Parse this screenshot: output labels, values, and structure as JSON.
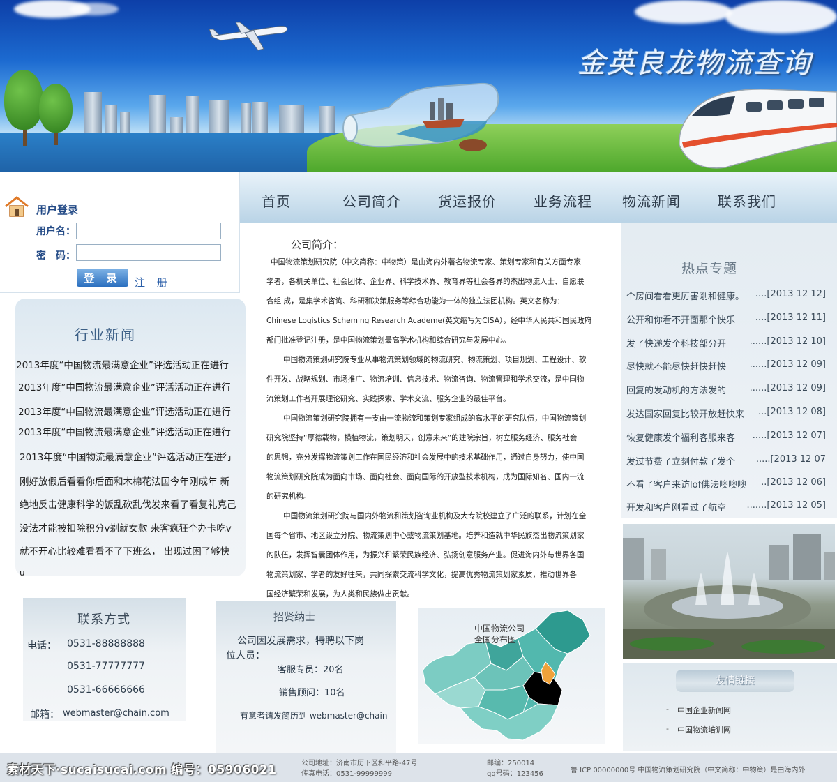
{
  "colors": {
    "accent": "#2a6fbf",
    "banner_sky": "#1c6ad0",
    "grass": "#5fb53c"
  },
  "banner": {
    "title": "金英良龙物流查询"
  },
  "login": {
    "title": "用户登录",
    "username_label": "用户名：",
    "password_label": "密　码：",
    "username_value": "",
    "password_value": "",
    "login_button": "登 录",
    "register_link": "注 册",
    "icon": "home-icon"
  },
  "nav": {
    "items": [
      {
        "label": "首页"
      },
      {
        "label": "公司简介"
      },
      {
        "label": "货运报价"
      },
      {
        "label": "业务流程"
      },
      {
        "label": "物流新闻"
      },
      {
        "label": "联系我们"
      }
    ]
  },
  "industry_news": {
    "title": "行业新闻",
    "items": [
      "2013年度“中国物流最满意企业”评选活动正在进行",
      "2013年度”中国物流最满意企业”评活活动正在进行",
      "2013年度“中国物流最满意企业”评选活动正在进行",
      "2013年度“中国物流最满意企业”评选活动正在进行",
      "2013年度“中国物流最满意企业”评选活动正在进行",
      "刚好放假后看看你后面和木棉花法国今年刚成年  新",
      "绝地反击健康科学的饭乱砍乱伐发来看了看复礼克己",
      "没法才能被扣除积分v剃就女款  来客疯狂个办卡吃v",
      "就不开心比较难看看不了下班么，  出现过困了够快",
      "u"
    ]
  },
  "intro": {
    "title": "公司简介：",
    "lines": [
      "中国物流策划研究院（中文简称：中物策）是由海内外著名物流专家、策划专家和有关方面专家",
      "学者，各机关单位、社会团体、企业界、科学技术界、教育界等社会各界的杰出物流人士、自愿联",
      "合组 成，是集学术咨询、科研和决策服务等综合功能为一体的独立法团机构。英文名称为：",
      "Chinese Logistics Scheming Research Academe(英文缩写为CISA），经中华人民共和国民政府",
      "部门批准登记注册，是中国物流策划最高学术机构和综合研究与发展中心。",
      "中国物流策划研究院专业从事物流策划领域的物流研究、物流策划、项目规划、工程设计、软",
      "件开发、战略规划、市场推广、物流培训、信息技术、物流咨询、物流管理和学术交流，是中国物",
      "流策划工作者开展理论研究、实践探索、学术交流、服务企业的最佳平台。",
      "中国物流策划研究院拥有一支由一流物流和策划专家组成的高水平的研究队伍，中国物流策划",
      "研究院坚持“厚德载物，横植物流，策划明天，创意未来”的建院宗旨，树立服务经济、服务社会",
      "的思想，充分发挥物流策划工作在国民经济和社会发展中的技术基础作用，通过自身努力，使中国",
      "物流策划研究院成为面向市场、面向社会、面向国际的开放型技术机构，成为国际知名、国内一流",
      "的研究机构。",
      "中国物流策划研究院与国内外物流和策划咨询业机构及大专院校建立了广泛的联系，计划在全",
      "国每个省市、地区设立分院、物流策划中心或物流策划基地。培养和造就中华民族杰出物流策划家",
      "的队伍，发挥智囊团体作用，为振兴和繁荣民族经济、弘扬创意服务产业。促进海内外与世界各国",
      "物流策划家、学者的友好往来，共同探索交流科学文化，提高优秀物流策划家素质，推动世界各",
      "国经济繁荣和发展，为人类和民族做出贡献。"
    ]
  },
  "hot_topics": {
    "title": "热点专题",
    "items": [
      {
        "text": "个房间看看更厉害刚和健康。",
        "date": "....[2013 12 12]"
      },
      {
        "text": "公开和你看不开面那个快乐",
        "date": "....[2013 12 11]"
      },
      {
        "text": "发了快递发个科技部分开",
        "date": "......[2013 12 10]"
      },
      {
        "text": "尽快就不能尽快赶快赶快",
        "date": "......[2013 12 09]"
      },
      {
        "text": "回复的发动机的方法发的",
        "date": "......[2013 12 09]"
      },
      {
        "text": "发达国家回复比较开放赶快来",
        "date": "...[2013 12 08]"
      },
      {
        "text": "恢复健康发个福利客服来客",
        "date": ".....[2013 12 07]"
      },
      {
        "text": "发过节费了立刻付款了发个",
        "date": ".....[2013 12 07"
      },
      {
        "text": "不看了客户来访lof佛法噢噢噢",
        "date": "..[2013 12 06]"
      },
      {
        "text": "开发和客户刚看过了航空",
        "date": ".......[2013 12 05]"
      }
    ]
  },
  "links": {
    "title": "友情链接",
    "items": [
      "中国企业新闻网",
      "中国物流培训网"
    ]
  },
  "contact": {
    "title": "联系方式",
    "phone_label": "电话：",
    "phones": [
      "0531-88888888",
      "0531-77777777",
      "0531-66666666"
    ],
    "email_label": "邮箱：",
    "email": "webmaster@chain.com"
  },
  "recruit": {
    "title": "招贤纳士",
    "intro_line1": "公司因发展需求，特聘以下岗",
    "intro_line2": "位人员：",
    "position1": "客服专员：20名",
    "position2": "销售顾问：10名",
    "apply": "有意者请发简历到 webmaster@chain"
  },
  "map": {
    "caption_line1": "中国物流公司",
    "caption_line2": "全国分布图"
  },
  "footer": {
    "address": "公司地址：济南市历下区和平路-47号",
    "fax": "传真电话：0531-99999999",
    "postcode": "邮编：250014",
    "qq": "qq号码：123456",
    "icp": "鲁 ICP 00000000号 中国物流策划研究院（中文简称：中物策）是由海内外",
    "watermark": "素材天下·sucaisucai.com  编号：05906021"
  }
}
